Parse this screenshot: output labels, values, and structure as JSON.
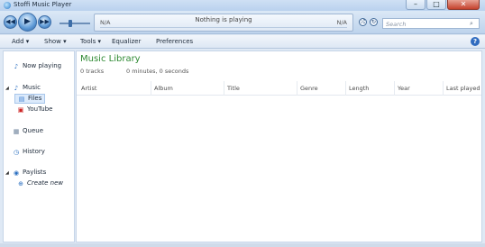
{
  "window": {
    "title": "Stoffi Music Player",
    "buttons": [
      "–",
      "□",
      "✕"
    ]
  },
  "player": {
    "position_left": "N/A",
    "now_playing": "Nothing is playing",
    "position_right": "N/A",
    "search_placeholder": "Search"
  },
  "menu": {
    "items": [
      "Add ▾",
      "Show ▾",
      "Tools ▾",
      "Equalizer",
      "Preferences"
    ]
  },
  "sidebar": {
    "now_playing": "Now playing",
    "music": "Music",
    "files": "Files",
    "youtube": "YouTube",
    "queue": "Queue",
    "history": "History",
    "playlists": "Paylists",
    "create_new": "Create new"
  },
  "library": {
    "title": "Music Library",
    "tracks": "0 tracks",
    "duration": "0 minutes, 0 seconds",
    "columns": [
      "Artist",
      "Album",
      "Title",
      "Genre",
      "Length",
      "Year",
      "Last played"
    ]
  }
}
